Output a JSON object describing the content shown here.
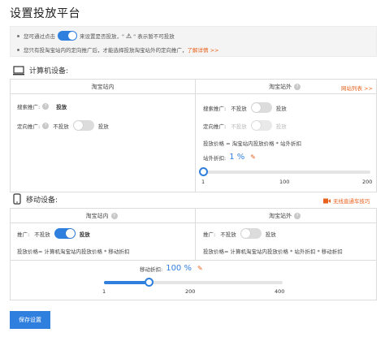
{
  "title": "设置投放平台",
  "notice": {
    "line1_pre": "您可通过点击",
    "line1_mid": "来设置是否投放，\"",
    "line1_post": "\" 表示暂不可投放",
    "line2_text": "您只有投淘宝站内的定向推广后，才能选择投放淘宝站外的定向推广，",
    "line2_link": "了解详情 >>"
  },
  "computer": {
    "heading": "计算机设备:",
    "col_inner": "淘宝站内",
    "col_outer": "淘宝站外",
    "site_list_link": "网站列表 >>",
    "inner": {
      "search_label": "搜索推广:",
      "search_value": "投放",
      "target_label": "定向推广:",
      "target_off": "不投放",
      "target_on": "投放"
    },
    "outer": {
      "search_label": "搜索推广:",
      "search_off": "不投放",
      "search_on": "投放",
      "target_label": "定向推广:",
      "target_off": "不投放",
      "target_on": "投放",
      "formula": "投放价格 = 淘宝站内投放价格 * 站外折扣",
      "discount_label": "站外折扣:",
      "discount_value": "1 %",
      "slider": {
        "min": 1,
        "max": 200,
        "value": 1,
        "ticks": [
          "1",
          "100",
          "200"
        ]
      }
    }
  },
  "mobile": {
    "heading": "移动设备:",
    "tips_link": "无线直通车技巧",
    "col_inner": "淘宝站内",
    "col_outer": "淘宝站外",
    "inner": {
      "promo_label": "推广:",
      "off": "不投放",
      "on": "投放",
      "formula": "投放价格= 计算机淘宝站内投放价格 * 移动折扣"
    },
    "outer": {
      "promo_label": "推广:",
      "off": "不投放",
      "on": "投放",
      "formula": "投放价格= 计算机淘宝站内投放价格 * 站外折扣 * 移动折扣"
    },
    "discount_label": "移动折扣:",
    "discount_value": "100 %",
    "slider": {
      "min": 1,
      "max": 400,
      "value": 100,
      "ticks": [
        "1",
        "200",
        "400"
      ]
    }
  },
  "save_button": "保存设置",
  "colors": {
    "accent": "#2f7fde",
    "link": "#e8621c"
  }
}
